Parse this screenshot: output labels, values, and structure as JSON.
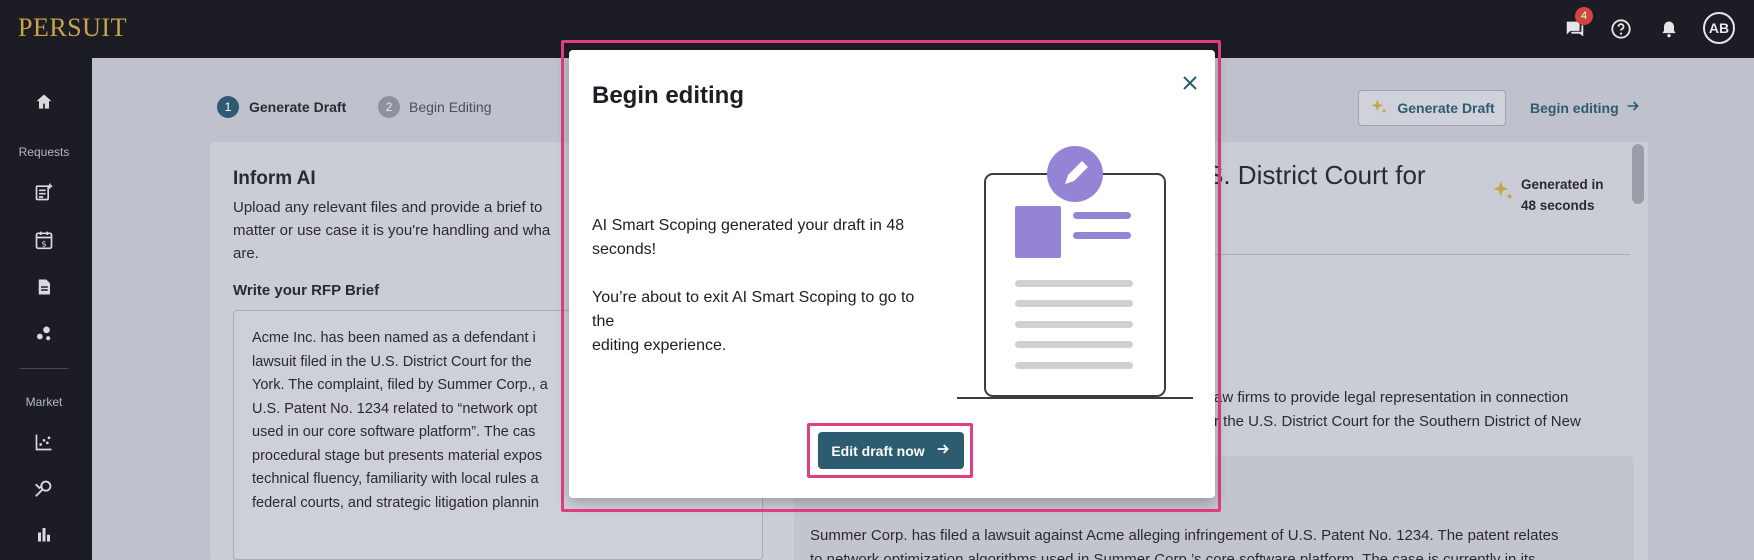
{
  "topbar": {
    "logo": "PERSUIT",
    "icons": [
      "chat-icon",
      "help-icon",
      "bell-icon"
    ],
    "notification_count": "4",
    "avatar_initials": "AB"
  },
  "sidebar": {
    "section_requests": "Requests",
    "section_market": "Market",
    "icons": [
      "home-icon",
      "new-request-icon",
      "calendar-dollar-icon",
      "document-icon",
      "share-nodes-icon",
      "scatter-chart-icon",
      "search-analytics-icon",
      "bar-chart-icon"
    ]
  },
  "stepper": {
    "steps": [
      {
        "number": "1",
        "label": "Generate Draft"
      },
      {
        "number": "2",
        "label": "Begin Editing"
      }
    ]
  },
  "header_actions": {
    "generate_draft": "Generate Draft",
    "begin_editing": "Begin editing"
  },
  "left_panel": {
    "title": "Inform AI",
    "description_lines": [
      "Upload any relevant files and provide a brief to",
      "matter or use case it is you're handling and wha",
      "are."
    ],
    "brief_label": "Write your RFP Brief",
    "brief_lines": [
      "Acme Inc. has been named as a defendant i",
      "lawsuit filed in the U.S. District Court for the",
      "York. The complaint, filed by Summer Corp., a",
      "U.S. Patent No. 1234 related to “network opt",
      "used in our core software platform”. The cas",
      "procedural stage but presents material expos",
      "technical fluency, familiarity with local rules a",
      "federal courts, and strategic litigation plannin"
    ]
  },
  "right_panel": {
    "title_fragment": "S. District Court for",
    "generated_line1": "Generated in",
    "generated_line2": "48 seconds",
    "paragraph1_line1": "aw firms to provide legal representation in connection",
    "paragraph1_line2": "r the U.S. District Court for the Southern District of New",
    "paragraph2_line1": "Summer Corp. has filed a lawsuit against Acme alleging infringement of U.S. Patent No. 1234. The patent relates",
    "paragraph2_line2": "to network optimization algorithms used in Summer Corp.’s core software platform. The case is currently in its"
  },
  "modal": {
    "title": "Begin editing",
    "text_1_line1": "AI Smart Scoping generated your draft in 48",
    "text_1_line2": "seconds!",
    "text_2_line1": "You’re about to exit AI Smart Scoping to go to the",
    "text_2_line2": "editing experience.",
    "primary_button": "Edit draft now"
  },
  "colors": {
    "brand_gold": "#c9a24a",
    "primary_teal": "#2d5b70",
    "highlight_pink": "#e0407f",
    "illustration_purple": "#9583d6"
  }
}
